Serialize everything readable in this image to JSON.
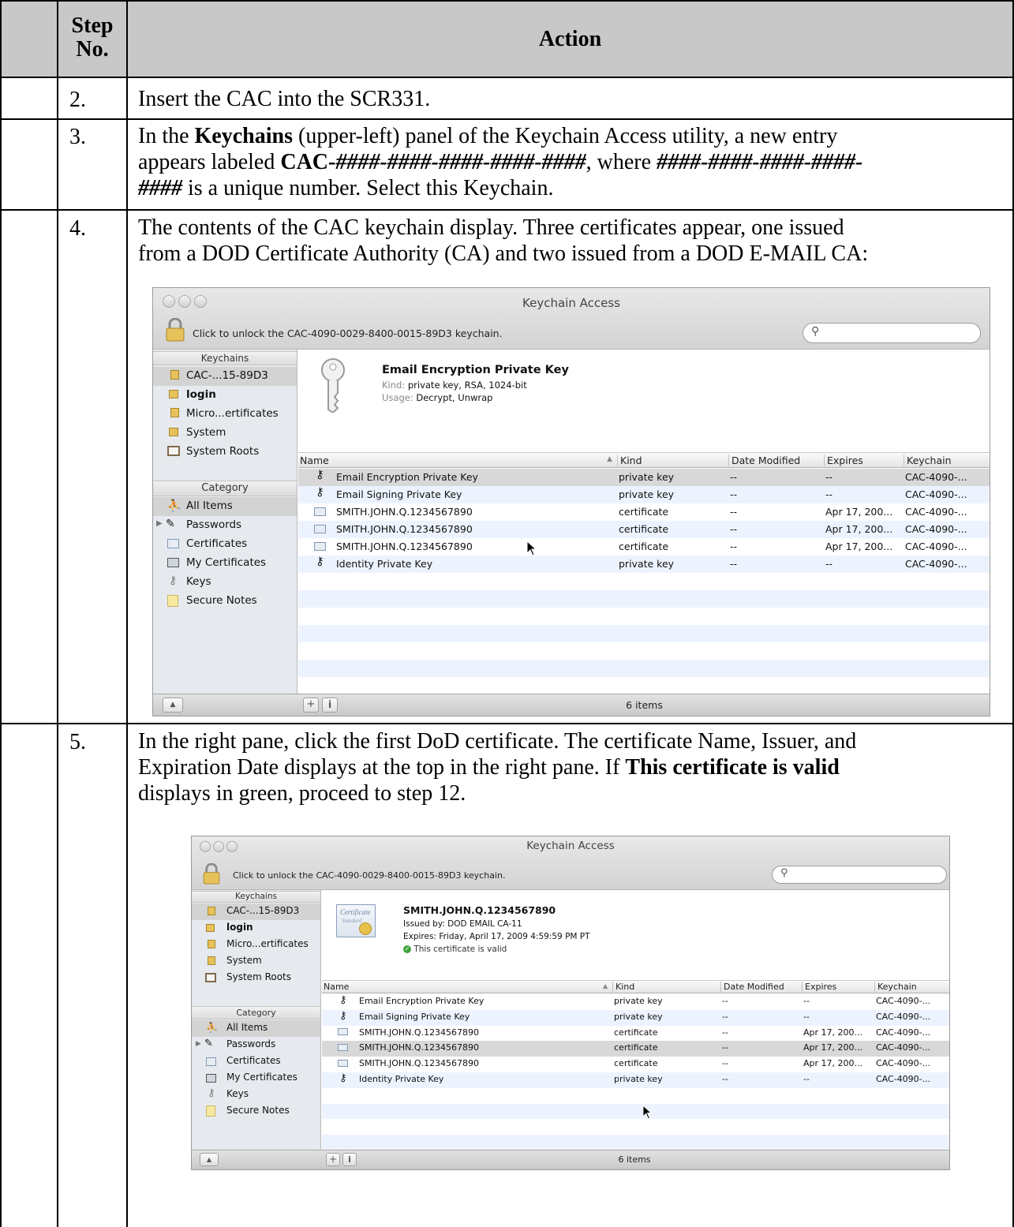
{
  "table": {
    "header": {
      "step_no": "Step No.",
      "action": "Action"
    },
    "rows": [
      {
        "step": "2.",
        "text": "Insert the CAC into the SCR331."
      },
      {
        "step": "3.",
        "line1_a": "In the ",
        "line1_b": "Keychains",
        "line1_c": " (upper-left) panel of the Keychain Access utility, a new entry",
        "line2_a": "appears labeled ",
        "line2_b": "CAC-",
        "line2_c": "####-####-####-####-####",
        "line2_d": ", where ",
        "line2_e": "####-####-####-####-",
        "line3_a": "####",
        "line3_b": " is a unique number.  Select this Keychain."
      },
      {
        "step": "4.",
        "line1": "The contents of the CAC keychain display.  Three certificates appear, one issued",
        "line2": "from a DOD Certificate Authority (CA) and two issued from a DOD E-MAIL CA:"
      },
      {
        "step": "5.",
        "line1": "In the right pane, click the first DoD certificate.  The certificate Name, Issuer, and",
        "line2_a": "Expiration Date displays at the top in the right pane.  If ",
        "line2_b": "This certificate is valid",
        "line3": "displays in green, proceed to step 12."
      }
    ]
  },
  "window1": {
    "title": "Keychain Access",
    "lock_message": "Click to unlock the CAC-4090-0029-8400-0015-89D3 keychain.",
    "search_placeholder": "",
    "keychains_header": "Keychains",
    "keychains": [
      "CAC-...15-89D3",
      "login",
      "Micro...ertificates",
      "System",
      "System Roots"
    ],
    "category_header": "Category",
    "categories": [
      "All Items",
      "Passwords",
      "Certificates",
      "My Certificates",
      "Keys",
      "Secure Notes"
    ],
    "detail": {
      "name": "Email Encryption Private Key",
      "kind_label": "Kind:",
      "kind": "private key, RSA, 1024-bit",
      "usage_label": "Usage:",
      "usage": "Decrypt, Unwrap"
    },
    "columns": [
      "Name",
      "Kind",
      "Date Modified",
      "Expires",
      "Keychain"
    ],
    "rows": [
      [
        "Email Encryption Private Key",
        "private key",
        "--",
        "--",
        "CAC-4090-..."
      ],
      [
        "Email Signing Private Key",
        "private key",
        "--",
        "--",
        "CAC-4090-..."
      ],
      [
        "SMITH.JOHN.Q.1234567890",
        "certificate",
        "--",
        "Apr 17, 200...",
        "CAC-4090-..."
      ],
      [
        "SMITH.JOHN.Q.1234567890",
        "certificate",
        "--",
        "Apr 17, 200...",
        "CAC-4090-..."
      ],
      [
        "SMITH.JOHN.Q.1234567890",
        "certificate",
        "--",
        "Apr 17, 200...",
        "CAC-4090-..."
      ],
      [
        "Identity Private Key",
        "private key",
        "--",
        "--",
        "CAC-4090-..."
      ]
    ],
    "status": "6 items",
    "sort_arrow": "▲"
  },
  "window2": {
    "title": "Keychain Access",
    "lock_message": "Click to unlock the CAC-4090-0029-8400-0015-89D3 keychain.",
    "keychains_header": "Keychains",
    "keychains": [
      "CAC-...15-89D3",
      "login",
      "Micro...ertificates",
      "System",
      "System Roots"
    ],
    "category_header": "Category",
    "categories": [
      "All Items",
      "Passwords",
      "Certificates",
      "My Certificates",
      "Keys",
      "Secure Notes"
    ],
    "detail": {
      "name": "SMITH.JOHN.Q.1234567890",
      "issued": "Issued by: DOD EMAIL CA-11",
      "expires": "Expires: Friday, April 17, 2009 4:59:59 PM PT",
      "valid": "This certificate is valid",
      "cert_word1": "Certificate",
      "cert_word2": "Standard"
    },
    "columns": [
      "Name",
      "Kind",
      "Date Modified",
      "Expires",
      "Keychain"
    ],
    "rows": [
      [
        "Email Encryption Private Key",
        "private key",
        "--",
        "--",
        "CAC-4090-..."
      ],
      [
        "Email Signing Private Key",
        "private key",
        "--",
        "--",
        "CAC-4090-..."
      ],
      [
        "SMITH.JOHN.Q.1234567890",
        "certificate",
        "--",
        "Apr 17, 200...",
        "CAC-4090-..."
      ],
      [
        "SMITH.JOHN.Q.1234567890",
        "certificate",
        "--",
        "Apr 17, 200...",
        "CAC-4090-..."
      ],
      [
        "SMITH.JOHN.Q.1234567890",
        "certificate",
        "--",
        "Apr 17, 200...",
        "CAC-4090-..."
      ],
      [
        "Identity Private Key",
        "private key",
        "--",
        "--",
        "CAC-4090-..."
      ]
    ],
    "status": "6 items",
    "sort_arrow": "▲"
  },
  "colors": {
    "header_bg": "#c8c8c8",
    "valid_green": "#3fa33a",
    "lock_gold": "#e7c15a"
  }
}
